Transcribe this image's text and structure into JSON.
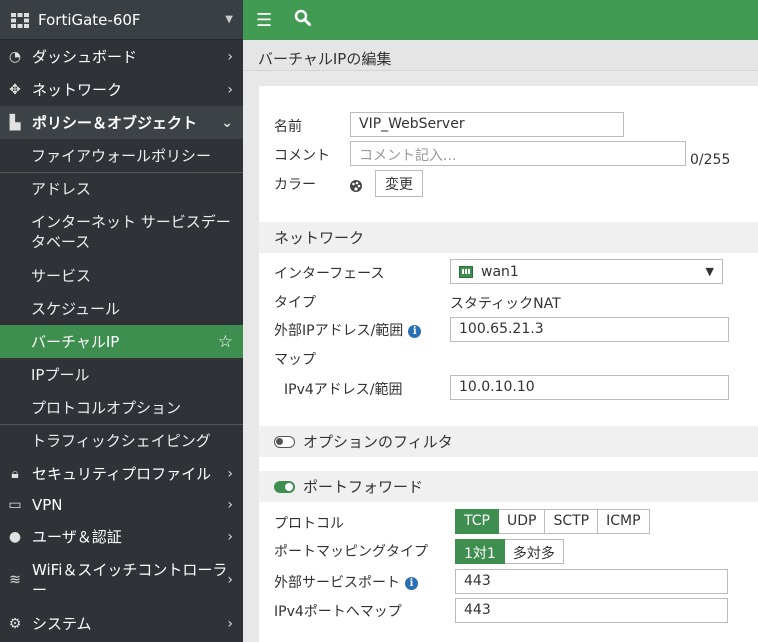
{
  "sidebar": {
    "device_name": "FortiGate-60F",
    "items": [
      {
        "label": "ダッシュボード",
        "icon": "dashboard-icon"
      },
      {
        "label": "ネットワーク",
        "icon": "network-icon"
      },
      {
        "label": "ポリシー＆オブジェクト",
        "icon": "policy-icon"
      },
      {
        "label": "セキュリティプロファイル",
        "icon": "lock-icon"
      },
      {
        "label": "VPN",
        "icon": "vpn-icon"
      },
      {
        "label": "ユーザ＆認証",
        "icon": "user-icon"
      },
      {
        "label": "WiFi＆スイッチコントローラー",
        "icon": "wifi-icon"
      },
      {
        "label": "システム",
        "icon": "gear-icon"
      }
    ],
    "sub_items": [
      "ファイアウォールポリシー",
      "アドレス",
      "インターネット サービスデータベース",
      "サービス",
      "スケジュール",
      "バーチャルIP",
      "IPプール",
      "プロトコルオプション",
      "トラフィックシェイピング"
    ]
  },
  "page": {
    "title": "バーチャルIPの編集"
  },
  "form": {
    "name_label": "名前",
    "name_value": "VIP_WebServer",
    "comment_label": "コメント",
    "comment_placeholder": "コメント記入...",
    "comment_counter": "0/255",
    "color_label": "カラー",
    "color_change_button": "変更",
    "network_section": "ネットワーク",
    "interface_label": "インターフェース",
    "interface_value": "wan1",
    "type_label": "タイプ",
    "type_value": "スタティックNAT",
    "external_ip_label": "外部IPアドレス/範囲",
    "external_ip_value": "100.65.21.3",
    "map_label": "マップ",
    "ipv4_label": "IPv4アドレス/範囲",
    "ipv4_value": "10.0.10.10",
    "option_filter_label": "オプションのフィルタ",
    "port_forward_label": "ポートフォワード",
    "protocol_label": "プロトコル",
    "protocol_options": [
      "TCP",
      "UDP",
      "SCTP",
      "ICMP"
    ],
    "port_mapping_label": "ポートマッピングタイプ",
    "port_mapping_options": [
      "1対1",
      "多対多"
    ],
    "external_port_label": "外部サービスポート",
    "external_port_value": "443",
    "ipv4_port_label": "IPv4ポートへマップ",
    "ipv4_port_value": "443"
  }
}
